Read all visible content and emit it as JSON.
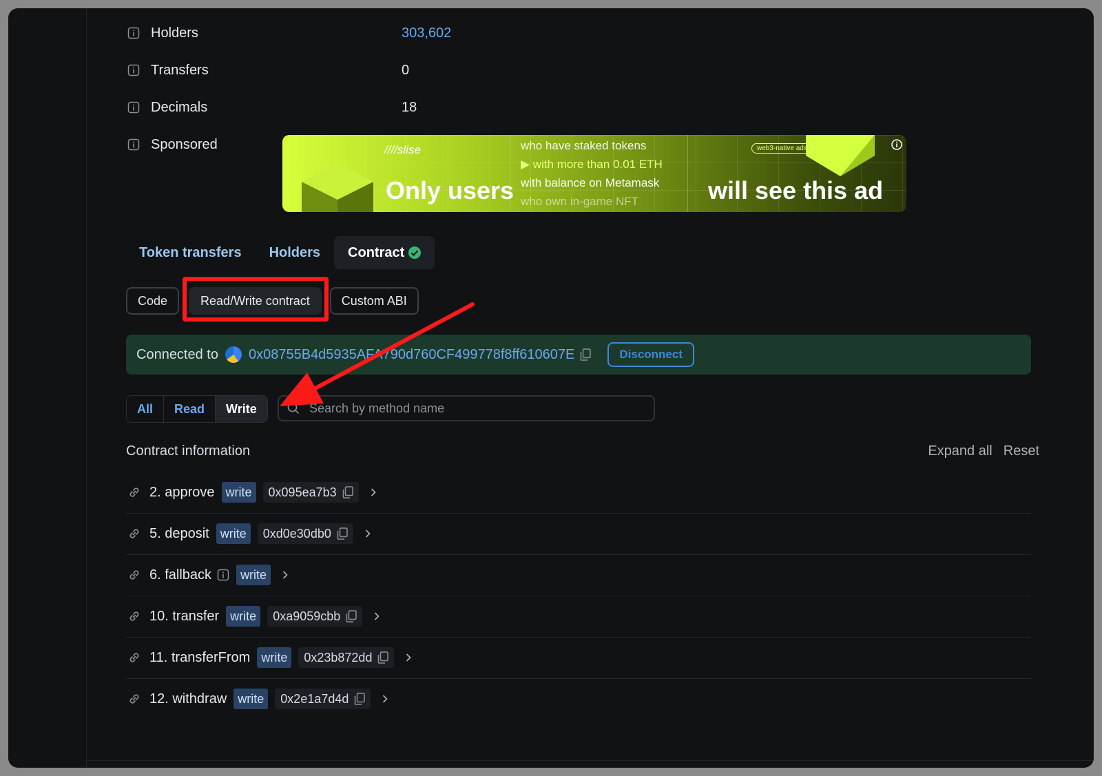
{
  "details": [
    {
      "label": "Holders",
      "value": "303,602",
      "is_link": true
    },
    {
      "label": "Transfers",
      "value": "0",
      "is_link": false
    },
    {
      "label": "Decimals",
      "value": "18",
      "is_link": false
    },
    {
      "label": "Sponsored",
      "value": "",
      "is_link": false
    }
  ],
  "ad": {
    "brand": "////slise",
    "headline_left": "Only users",
    "lines": [
      "who have staked tokens",
      "▶ with more than 0.01 ETH",
      "with balance on Metamask",
      "who own in-game NFT"
    ],
    "tag": "web3-native ads",
    "headline_right": "will see this ad"
  },
  "tabs": [
    {
      "label": "Token transfers"
    },
    {
      "label": "Holders"
    },
    {
      "label": "Contract",
      "active": true
    }
  ],
  "subtabs": [
    {
      "label": "Code"
    },
    {
      "label": "Read/Write contract",
      "active": true
    },
    {
      "label": "Custom ABI"
    }
  ],
  "connection": {
    "label": "Connected to",
    "address": "0x08755B4d5935AFA790d760CF499778f8ff610607E",
    "disconnect_label": "Disconnect"
  },
  "filters": [
    {
      "label": "All"
    },
    {
      "label": "Read"
    },
    {
      "label": "Write",
      "active": true
    }
  ],
  "search": {
    "placeholder": "Search by method name",
    "value": ""
  },
  "contract_info": {
    "title": "Contract information",
    "expand_all": "Expand all",
    "reset": "Reset"
  },
  "methods": [
    {
      "name": "2. approve",
      "badge": "write",
      "selector": "0x095ea7b3"
    },
    {
      "name": "5. deposit",
      "badge": "write",
      "selector": "0xd0e30db0"
    },
    {
      "name": "6. fallback",
      "badge": "write",
      "selector": ""
    },
    {
      "name": "10. transfer",
      "badge": "write",
      "selector": "0xa9059cbb"
    },
    {
      "name": "11. transferFrom",
      "badge": "write",
      "selector": "0x23b872dd"
    },
    {
      "name": "12. withdraw",
      "badge": "write",
      "selector": "0x2e1a7d4d"
    }
  ],
  "colors": {
    "accent": "#6aa8f0",
    "connected_bg": "#1b3a2b",
    "highlight": "#ff1a1a",
    "badge_bg": "#2a4365",
    "verified": "#3bb273"
  }
}
